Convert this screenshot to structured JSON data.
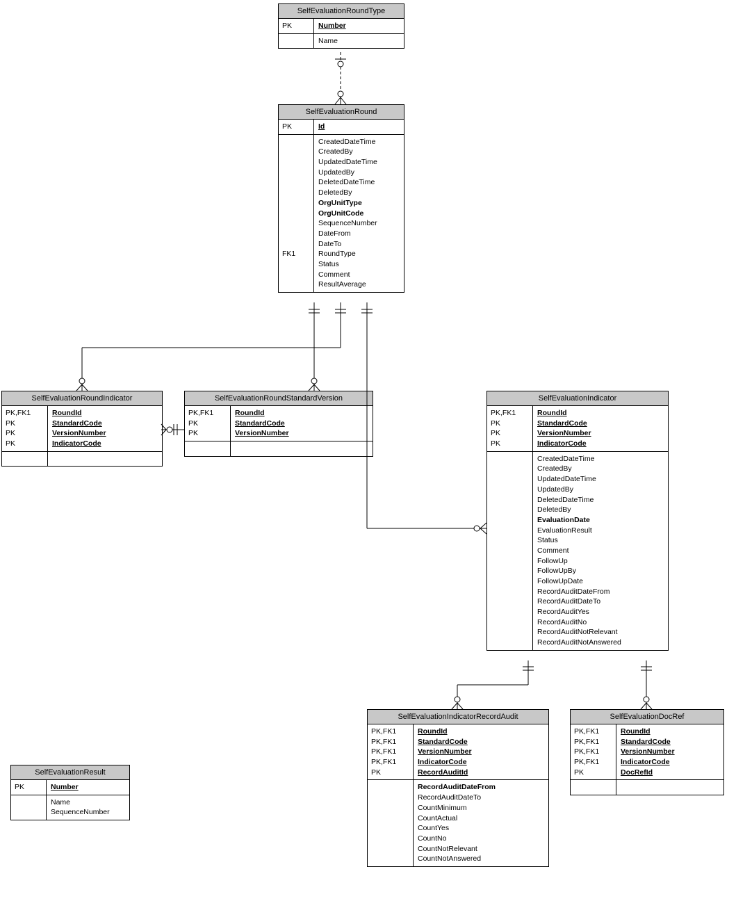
{
  "entities": {
    "roundType": {
      "name": "SelfEvaluationRoundType",
      "pk": [
        {
          "key": "PK",
          "attr": "Number"
        }
      ],
      "attrs": [
        {
          "key": "",
          "attr": "Name"
        }
      ]
    },
    "round": {
      "name": "SelfEvaluationRound",
      "pk": [
        {
          "key": "PK",
          "attr": "Id"
        }
      ],
      "attrsKeys": [
        "",
        "",
        "",
        "",
        "",
        "",
        "",
        "",
        "",
        "",
        "",
        "FK1",
        "",
        "",
        ""
      ],
      "attrs": [
        "CreatedDateTime",
        "CreatedBy",
        "UpdatedDateTime",
        "UpdatedBy",
        "DeletedDateTime",
        "DeletedBy",
        "OrgUnitType",
        "OrgUnitCode",
        "SequenceNumber",
        "DateFrom",
        "DateTo",
        "RoundType",
        "Status",
        "Comment",
        "ResultAverage"
      ],
      "bold": [
        "OrgUnitType",
        "OrgUnitCode"
      ]
    },
    "roundIndicator": {
      "name": "SelfEvaluationRoundIndicator",
      "pk": [
        {
          "key": "PK,FK1",
          "attr": "RoundId"
        },
        {
          "key": "PK",
          "attr": "StandardCode"
        },
        {
          "key": "PK",
          "attr": "VersionNumber"
        },
        {
          "key": "PK",
          "attr": "IndicatorCode"
        }
      ]
    },
    "roundStdVer": {
      "name": "SelfEvaluationRoundStandardVersion",
      "pk": [
        {
          "key": "PK,FK1",
          "attr": "RoundId"
        },
        {
          "key": "PK",
          "attr": "StandardCode"
        },
        {
          "key": "PK",
          "attr": "VersionNumber"
        }
      ]
    },
    "indicator": {
      "name": "SelfEvaluationIndicator",
      "pk": [
        {
          "key": "PK,FK1",
          "attr": "RoundId"
        },
        {
          "key": "PK",
          "attr": "StandardCode"
        },
        {
          "key": "PK",
          "attr": "VersionNumber"
        },
        {
          "key": "PK",
          "attr": "IndicatorCode"
        }
      ],
      "attrs": [
        "CreatedDateTime",
        "CreatedBy",
        "UpdatedDateTime",
        "UpdatedBy",
        "DeletedDateTime",
        "DeletedBy",
        "EvaluationDate",
        "EvaluationResult",
        "Status",
        "Comment",
        "FollowUp",
        "FollowUpBy",
        "FollowUpDate",
        "RecordAuditDateFrom",
        "RecordAuditDateTo",
        "RecordAuditYes",
        "RecordAuditNo",
        "RecordAuditNotRelevant",
        "RecordAuditNotAnswered"
      ],
      "bold": [
        "EvaluationDate"
      ]
    },
    "recordAudit": {
      "name": "SelfEvaluationIndicatorRecordAudit",
      "pk": [
        {
          "key": "PK,FK1",
          "attr": "RoundId"
        },
        {
          "key": "PK,FK1",
          "attr": "StandardCode"
        },
        {
          "key": "PK,FK1",
          "attr": "VersionNumber"
        },
        {
          "key": "PK,FK1",
          "attr": "IndicatorCode"
        },
        {
          "key": "PK",
          "attr": "RecordAuditId"
        }
      ],
      "attrs": [
        "RecordAuditDateFrom",
        "RecordAuditDateTo",
        "CountMinimum",
        "CountActual",
        "CountYes",
        "CountNo",
        "CountNotRelevant",
        "CountNotAnswered"
      ],
      "bold": [
        "RecordAuditDateFrom"
      ]
    },
    "docRef": {
      "name": "SelfEvaluationDocRef",
      "pk": [
        {
          "key": "PK,FK1",
          "attr": "RoundId"
        },
        {
          "key": "PK,FK1",
          "attr": "StandardCode"
        },
        {
          "key": "PK,FK1",
          "attr": "VersionNumber"
        },
        {
          "key": "PK,FK1",
          "attr": "IndicatorCode"
        },
        {
          "key": "PK",
          "attr": "DocRefId"
        }
      ]
    },
    "result": {
      "name": "SelfEvaluationResult",
      "pk": [
        {
          "key": "PK",
          "attr": "Number"
        }
      ],
      "attrs": [
        "Name",
        "SequenceNumber"
      ]
    }
  }
}
